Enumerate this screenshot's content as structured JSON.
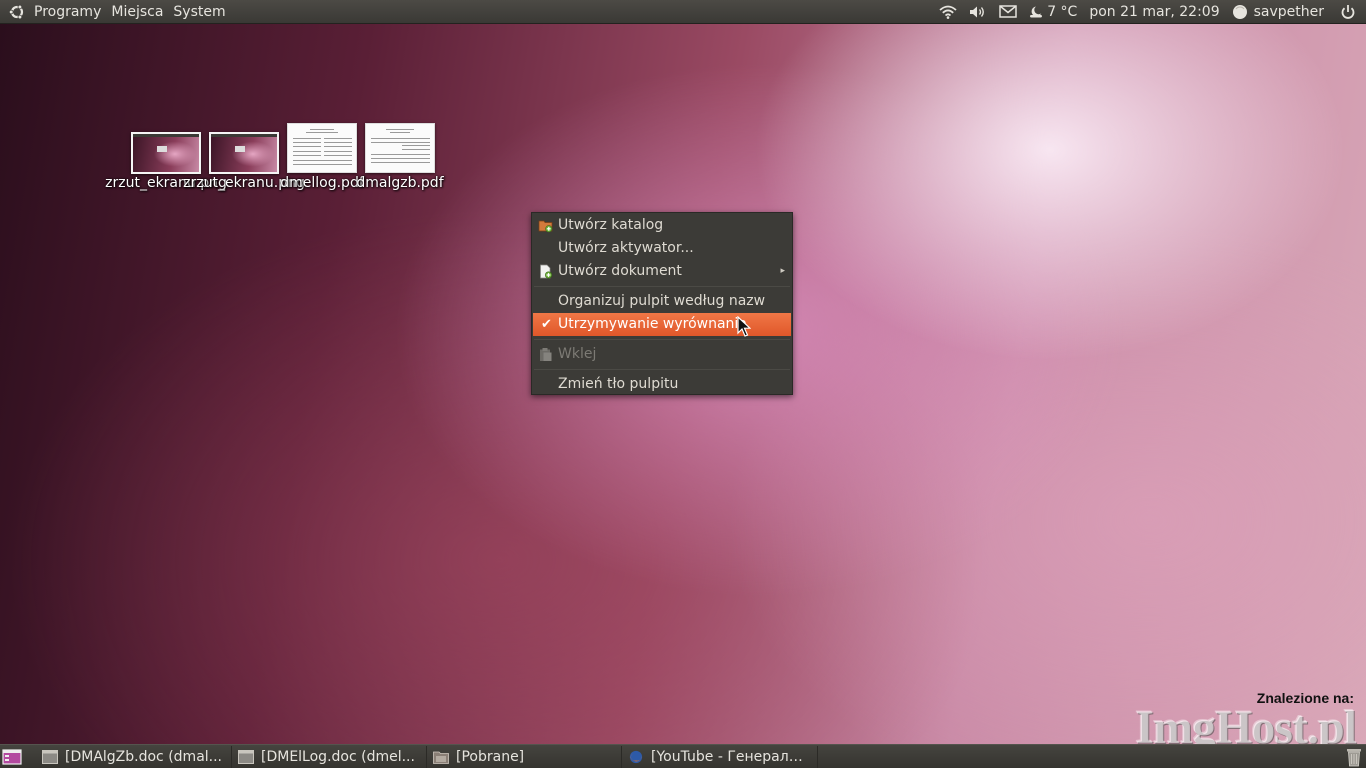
{
  "top_panel": {
    "menus": [
      "Programy",
      "Miejsca",
      "System"
    ],
    "weather": "7 °C",
    "clock": "pon 21 mar, 22:09",
    "user": "savpether",
    "icons": [
      "ubuntu-logo-icon",
      "wifi-icon",
      "volume-icon",
      "mail-icon",
      "weather-icon",
      "user-status-icon",
      "power-icon"
    ]
  },
  "desktop_icons": [
    {
      "label": "zrzut_ekranu.png",
      "kind": "image"
    },
    {
      "label": "zrzut_ekranu.png",
      "kind": "image"
    },
    {
      "label": "dmellog.pdf",
      "kind": "pdf"
    },
    {
      "label": "dmalgzb.pdf",
      "kind": "pdf"
    }
  ],
  "context_menu": {
    "items": [
      {
        "label": "Utwórz katalog",
        "icon": "folder-new-icon"
      },
      {
        "label": "Utwórz aktywator...",
        "icon": ""
      },
      {
        "label": "Utwórz dokument",
        "icon": "document-new-icon",
        "submenu": true
      },
      {
        "label": "Organizuj pulpit według nazw",
        "icon": ""
      },
      {
        "label": "Utrzymywanie wyrównania",
        "checked": true,
        "highlighted": true
      },
      {
        "label": "Wklej",
        "icon": "paste-icon",
        "disabled": true
      },
      {
        "label": "Zmień tło pulpitu",
        "icon": ""
      }
    ]
  },
  "taskbar": {
    "tasks": [
      {
        "label": "[DMAlgZb.doc (dmal...",
        "icon": "window-icon"
      },
      {
        "label": "[DMElLog.doc (dmel...",
        "icon": "window-icon"
      },
      {
        "label": "[Pobrane]",
        "icon": "folder-icon"
      },
      {
        "label": "[YouTube - Генералы...",
        "icon": "firefox-icon"
      }
    ]
  },
  "watermark": {
    "caption": "Znalezione na:",
    "logo": "ImgHost.pl"
  },
  "colors": {
    "panel": "#3c3b37",
    "menu_bg": "#3c3b37",
    "highlight": "#e8642f"
  }
}
